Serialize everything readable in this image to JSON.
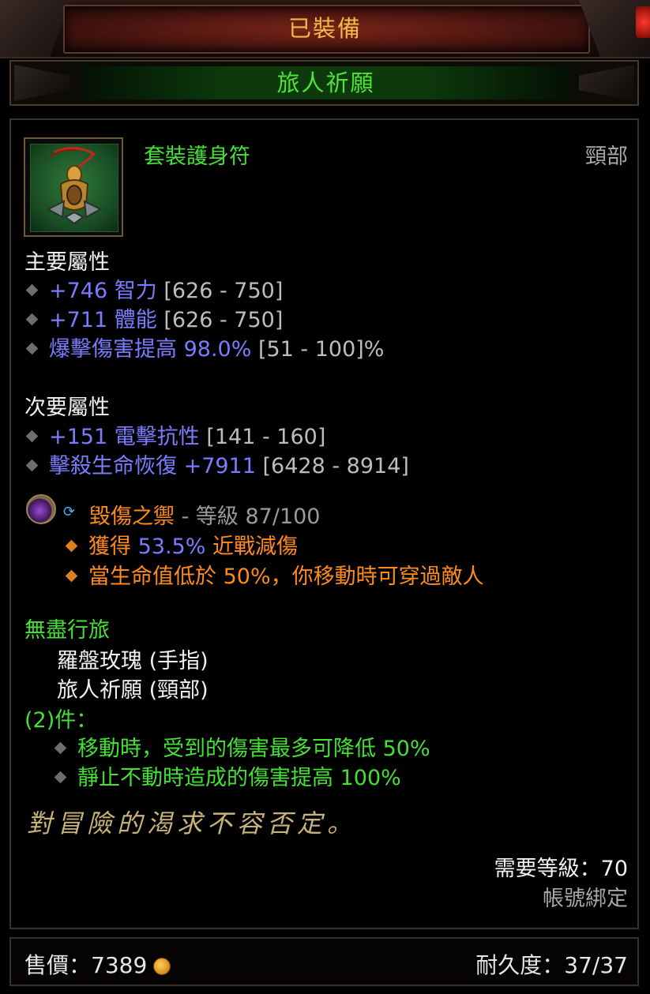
{
  "header": {
    "status": "已裝備"
  },
  "item": {
    "name": "旅人祈願",
    "type": "套裝護身符",
    "slot": "頸部",
    "icon": "amulet-icon"
  },
  "primary": {
    "title": "主要屬性",
    "affixes": [
      {
        "value": "+746 智力",
        "range": " [626 - 750]"
      },
      {
        "value": "+711 體能",
        "range": " [626 - 750]"
      },
      {
        "value": "爆擊傷害提高 98.0%",
        "range": " [51 - 100]%"
      }
    ]
  },
  "secondary": {
    "title": "次要屬性",
    "affixes": [
      {
        "value": "+151 電擊抗性",
        "range": " [141 - 160]"
      },
      {
        "value": "擊殺生命恢復 +7911",
        "range": " [6428 - 8914]"
      }
    ]
  },
  "gem": {
    "name": "毀傷之禦",
    "rank": " - 等級 87/100",
    "effects": [
      {
        "prefix": "獲得 ",
        "num": "53.5%",
        "suffix": " 近戰減傷"
      },
      {
        "text": "當生命值低於 50%，你移動時可穿過敵人"
      }
    ]
  },
  "set": {
    "name": "無盡行旅",
    "pieces": [
      "羅盤玫瑰 (手指)",
      "旅人祈願 (頸部)"
    ],
    "count_label": "(2)件：",
    "bonuses": [
      "移動時，受到的傷害最多可降低 50%",
      "靜止不動時造成的傷害提高 100%"
    ]
  },
  "flavor": "對冒險的渴求不容否定。",
  "requirements": {
    "level": "需要等級：70",
    "binding": "帳號綁定"
  },
  "footer": {
    "sell_price": "售價：7389",
    "durability": "耐久度：37/37"
  },
  "colors": {
    "header": "#f2b84a",
    "set_green": "#44e036",
    "magic_blue": "#7a7cff",
    "gem_orange": "#ff8a1e"
  }
}
